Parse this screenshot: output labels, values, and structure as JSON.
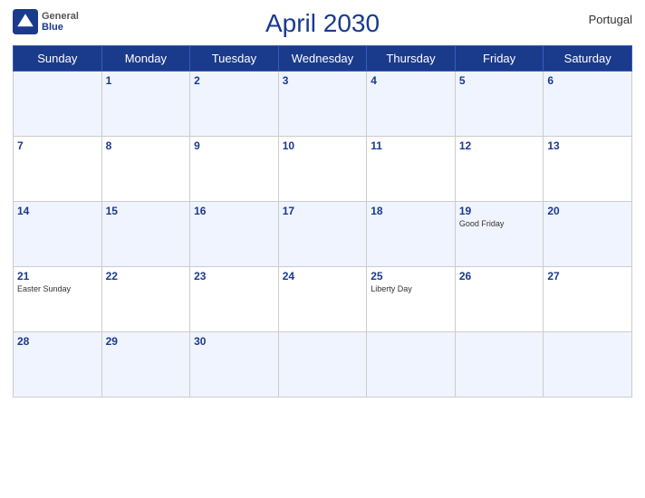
{
  "header": {
    "title": "April 2030",
    "country": "Portugal",
    "logo": {
      "general": "General",
      "blue": "Blue"
    }
  },
  "weekdays": [
    "Sunday",
    "Monday",
    "Tuesday",
    "Wednesday",
    "Thursday",
    "Friday",
    "Saturday"
  ],
  "weeks": [
    [
      {
        "day": "",
        "holiday": ""
      },
      {
        "day": "1",
        "holiday": ""
      },
      {
        "day": "2",
        "holiday": ""
      },
      {
        "day": "3",
        "holiday": ""
      },
      {
        "day": "4",
        "holiday": ""
      },
      {
        "day": "5",
        "holiday": ""
      },
      {
        "day": "6",
        "holiday": ""
      }
    ],
    [
      {
        "day": "7",
        "holiday": ""
      },
      {
        "day": "8",
        "holiday": ""
      },
      {
        "day": "9",
        "holiday": ""
      },
      {
        "day": "10",
        "holiday": ""
      },
      {
        "day": "11",
        "holiday": ""
      },
      {
        "day": "12",
        "holiday": ""
      },
      {
        "day": "13",
        "holiday": ""
      }
    ],
    [
      {
        "day": "14",
        "holiday": ""
      },
      {
        "day": "15",
        "holiday": ""
      },
      {
        "day": "16",
        "holiday": ""
      },
      {
        "day": "17",
        "holiday": ""
      },
      {
        "day": "18",
        "holiday": ""
      },
      {
        "day": "19",
        "holiday": "Good Friday"
      },
      {
        "day": "20",
        "holiday": ""
      }
    ],
    [
      {
        "day": "21",
        "holiday": "Easter Sunday"
      },
      {
        "day": "22",
        "holiday": ""
      },
      {
        "day": "23",
        "holiday": ""
      },
      {
        "day": "24",
        "holiday": ""
      },
      {
        "day": "25",
        "holiday": "Liberty Day"
      },
      {
        "day": "26",
        "holiday": ""
      },
      {
        "day": "27",
        "holiday": ""
      }
    ],
    [
      {
        "day": "28",
        "holiday": ""
      },
      {
        "day": "29",
        "holiday": ""
      },
      {
        "day": "30",
        "holiday": ""
      },
      {
        "day": "",
        "holiday": ""
      },
      {
        "day": "",
        "holiday": ""
      },
      {
        "day": "",
        "holiday": ""
      },
      {
        "day": "",
        "holiday": ""
      }
    ]
  ]
}
